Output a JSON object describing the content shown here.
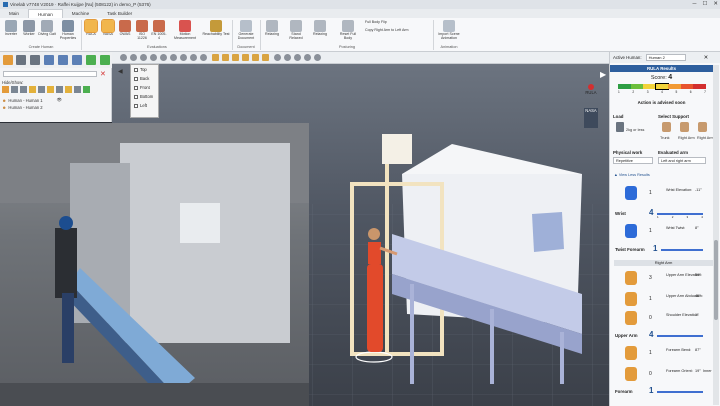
{
  "window": {
    "title": "Vinelab v7748 V2019 · Raffei Kuijpe [Nu] (508122) in demo_P (5376)"
  },
  "tabs": [
    "Main",
    "Human",
    "Machine",
    "Task Builder"
  ],
  "ribbon": {
    "buttons": [
      "Inverter",
      "Worker",
      "Diving Gait",
      "Human Properties",
      "RULA",
      "NASA",
      "OWAS",
      "ISO 11226",
      "EN 1005-4",
      "Motion Measurement",
      "Reachability Test",
      "Generate Document",
      "Relaxing",
      "Stand Relaxed",
      "Relaxing",
      "Reset Full Body",
      "Import Scene Animation"
    ],
    "small_items": [
      "Full Body Flip",
      "Copy Right Arm to Left Arm"
    ],
    "groups": [
      "Create Human",
      "Evaluations",
      "Document",
      "Posturing",
      "Animation"
    ]
  },
  "left_panel": {
    "search_placeholder": "",
    "hide_show": "Hide/Show:",
    "items": [
      "Human - Human 1",
      "Human - Human 2"
    ]
  },
  "view_menu": [
    "Top",
    "Back",
    "Front",
    "Bottom",
    "Left"
  ],
  "viewport_badges": [
    "RULA",
    "NASA"
  ],
  "right_panel": {
    "active_human_label": "Active Human:",
    "active_human_value": "Human 2",
    "title": "RULA Results",
    "score_label": "Score:",
    "score_value": "4",
    "score_scale": [
      "1",
      "2",
      "3",
      "4",
      "5",
      "6",
      "7"
    ],
    "advice": "Action is advised soon",
    "load_label": "Load",
    "support_label": "Select Support",
    "load_value": "2kg or less",
    "support_options": [
      "Trunk",
      "Right Arm",
      "Right Arm"
    ],
    "physical_work_label": "Physical work",
    "evaluated_arm_label": "Evaluated arm",
    "physical_work_value": "Repetitive",
    "evaluated_arm_value": "Left and right arm",
    "view_less": "View Less Results",
    "rows": [
      {
        "label": "Wrist Elevation:",
        "value": "-11°",
        "score": "1"
      },
      {
        "label": "Wrist Twist:",
        "value": "8°",
        "score": "1"
      }
    ],
    "groups": [
      {
        "label": "Wrist",
        "score": "4"
      },
      {
        "label": "Twist Forearm",
        "score": "1"
      }
    ],
    "section_right_arm": "Right Arm",
    "arm_rows": [
      {
        "label": "Upper Arm Elevation:",
        "value": "59°",
        "score": "3"
      },
      {
        "label": "Upper Arm Abduction:",
        "value": "46°",
        "score": "1"
      },
      {
        "label": "Shoulder Elevation:",
        "value": "1°",
        "score": "0"
      }
    ],
    "upper_arm_group": {
      "label": "Upper Arm",
      "score": "4"
    },
    "forearm_rows": [
      {
        "label": "Forearm Bend:",
        "value": "87°",
        "score": "1"
      },
      {
        "label": "Forearm Orient:",
        "value": "19°",
        "extra": "Inner",
        "score": "0"
      }
    ],
    "forearm_group": {
      "label": "Forearm",
      "score": "1"
    }
  },
  "colors": {
    "accent": "#2e5f9e",
    "select": "#e39b3b"
  }
}
